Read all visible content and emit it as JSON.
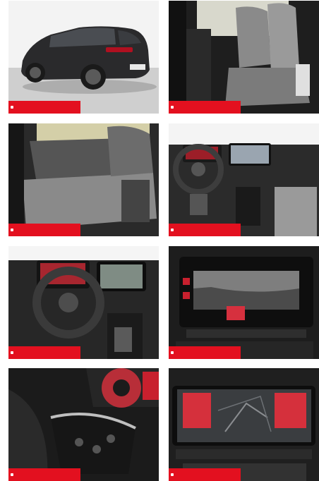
{
  "gallery": {
    "accent_color": "#e3101f",
    "photos": [
      {
        "subject": "car-rear-three-quarter"
      },
      {
        "subject": "front-seats"
      },
      {
        "subject": "rear-seats"
      },
      {
        "subject": "dashboard-steering-wheel"
      },
      {
        "subject": "cockpit-close"
      },
      {
        "subject": "infotainment-screen"
      },
      {
        "subject": "steering-wheel-buttons"
      },
      {
        "subject": "navigation-display"
      }
    ]
  }
}
